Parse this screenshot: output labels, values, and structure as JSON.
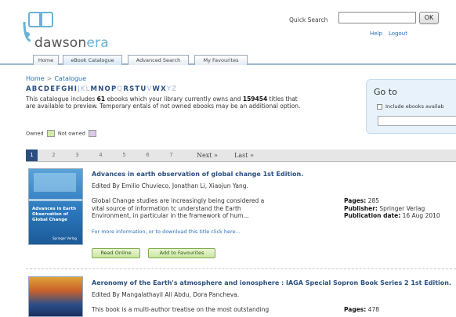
{
  "header": {
    "logo_text_main": "dawson",
    "logo_text_accent": "era",
    "quick_search_label": "Quick Search",
    "quick_search_value": "",
    "ok_label": "OK",
    "help_label": "Help",
    "logout_label": "Logout"
  },
  "tabs": [
    {
      "label": "Home"
    },
    {
      "label": "eBook Catalogue"
    },
    {
      "label": "Advanced Search"
    },
    {
      "label": "My Favourites"
    }
  ],
  "breadcrumb": {
    "home": "Home",
    "sep": ">",
    "current": "Catalogue"
  },
  "letters": {
    "active": [
      "A",
      "B",
      "C",
      "D",
      "E",
      "F",
      "G",
      "H",
      "I",
      "M",
      "N",
      "O",
      "P",
      "R",
      "S",
      "T",
      "U",
      "W",
      "X"
    ],
    "inactive": [
      "J",
      "K",
      "L",
      "Q",
      "V",
      "Y",
      "Z"
    ],
    "sequence": [
      "A",
      "B",
      "C",
      "D",
      "E",
      "F",
      "G",
      "H",
      "I",
      "J",
      "K",
      "L",
      "M",
      "N",
      "O",
      "P",
      "Q",
      "R",
      "S",
      "T",
      "U",
      "V",
      "W",
      "X",
      "Y",
      "Z"
    ]
  },
  "intro": {
    "part1": "This catalogue includes ",
    "owned_count": "61",
    "part2": " ebooks which your library currently owns and ",
    "preview_count": "159454",
    "part3": " titles that are available to preview. Temporary ",
    "part4": "entals of not owned ebooks may be an additional option."
  },
  "legend": {
    "owned": "Owned",
    "not_owned": "Not owned",
    "owned_color": "#d2eaa9",
    "not_owned_color": "#dccbe8"
  },
  "goto": {
    "title": "Go to",
    "include_label": "Include ebooks availab",
    "input_value": ""
  },
  "pagination": {
    "pages": [
      "1",
      "2",
      "3",
      "4",
      "5",
      "6",
      "7"
    ],
    "current": "1",
    "next_label": "Next »",
    "last_label": "Last »"
  },
  "books": [
    {
      "title": "Advances in earth observation of global change 1st Edition.",
      "editors": "Edited By Emilio Chuvieco, Jonathan Li, Xiaojun Yang.",
      "desc_lines": [
        "Global Change studies are increasingly being considered a",
        "vital source of information tc understand the Earth",
        "Environment, in particular in the framework of hum..."
      ],
      "more": "For more information, or to download this title click here...",
      "pages_label": "Pages:",
      "pages": "285",
      "publisher_label": "Publisher:",
      "publisher": "Springer Verlag",
      "date_label": "Publication date:",
      "date": "16 Aug 2010",
      "read_label": "Read Online",
      "fav_label": "Add to Favourites",
      "cover_title": "Advances in Earth Observation of Global Change"
    },
    {
      "title": "Aeronomy of the Earth's atmosphere and ionosphere : IAGA Special Sopron Book Series 2 1st Edition.",
      "editors": "Edited By Mangalathayil Ali Abdu, Dora Pancheva.",
      "desc_lines": [
        "This book is a multi-author treatise on the most outstanding"
      ],
      "pages_label": "Pages:",
      "pages": "478"
    }
  ]
}
